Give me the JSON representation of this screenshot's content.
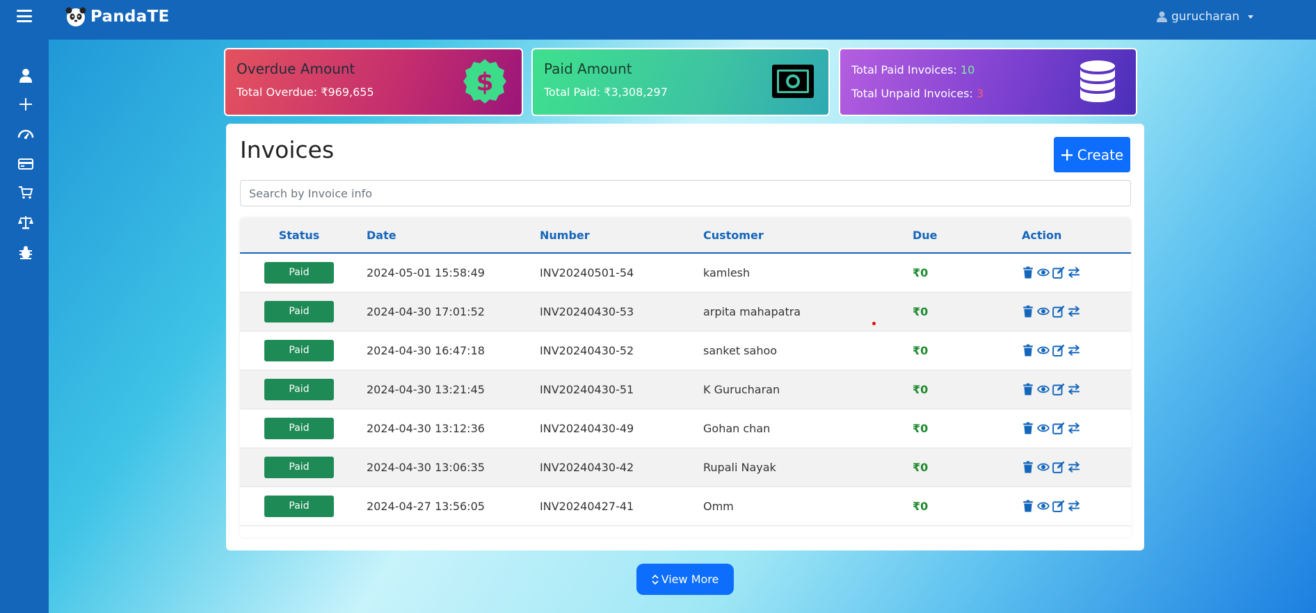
{
  "app": {
    "name": "PandaTE"
  },
  "header": {
    "username": "gurucharan"
  },
  "sidebar": {
    "icons": [
      "user-icon",
      "plus-icon",
      "dashboard-icon",
      "credit-card-icon",
      "cart-icon",
      "scale-icon",
      "bug-icon"
    ]
  },
  "summary": {
    "overdue": {
      "title": "Overdue Amount",
      "label": "Total Overdue: ₹969,655"
    },
    "paid": {
      "title": "Paid Amount",
      "label": "Total Paid: ₹3,308,297"
    },
    "totals": {
      "paid_label": "Total Paid Invoices: ",
      "paid_count": "10",
      "unpaid_label": "Total Unpaid Invoices: ",
      "unpaid_count": "3"
    }
  },
  "invoices": {
    "title": "Invoices",
    "create_label": "Create",
    "search_placeholder": "Search by Invoice info",
    "columns": [
      "Status",
      "Date",
      "Number",
      "Customer",
      "Due",
      "Action"
    ],
    "rows": [
      {
        "status": "Paid",
        "date": "2024-05-01 15:58:49",
        "number": "INV20240501-54",
        "customer": "kamlesh",
        "due": "₹0"
      },
      {
        "status": "Paid",
        "date": "2024-04-30 17:01:52",
        "number": "INV20240430-53",
        "customer": "arpita mahapatra",
        "due": "₹0"
      },
      {
        "status": "Paid",
        "date": "2024-04-30 16:47:18",
        "number": "INV20240430-52",
        "customer": "sanket sahoo",
        "due": "₹0"
      },
      {
        "status": "Paid",
        "date": "2024-04-30 13:21:45",
        "number": "INV20240430-51",
        "customer": "K Gurucharan",
        "due": "₹0"
      },
      {
        "status": "Paid",
        "date": "2024-04-30 13:12:36",
        "number": "INV20240430-49",
        "customer": "Gohan chan",
        "due": "₹0"
      },
      {
        "status": "Paid",
        "date": "2024-04-30 13:06:35",
        "number": "INV20240430-42",
        "customer": "Rupali Nayak",
        "due": "₹0"
      },
      {
        "status": "Paid",
        "date": "2024-04-27 13:56:05",
        "number": "INV20240427-41",
        "customer": "Omm",
        "due": "₹0"
      }
    ],
    "view_more_label": "View More"
  },
  "colors": {
    "nav": "#1466bb",
    "primary": "#0d6efd",
    "paid_status": "#1e8a55",
    "paid_count": "#7ef0a0",
    "unpaid_count": "#ff5a6e"
  }
}
